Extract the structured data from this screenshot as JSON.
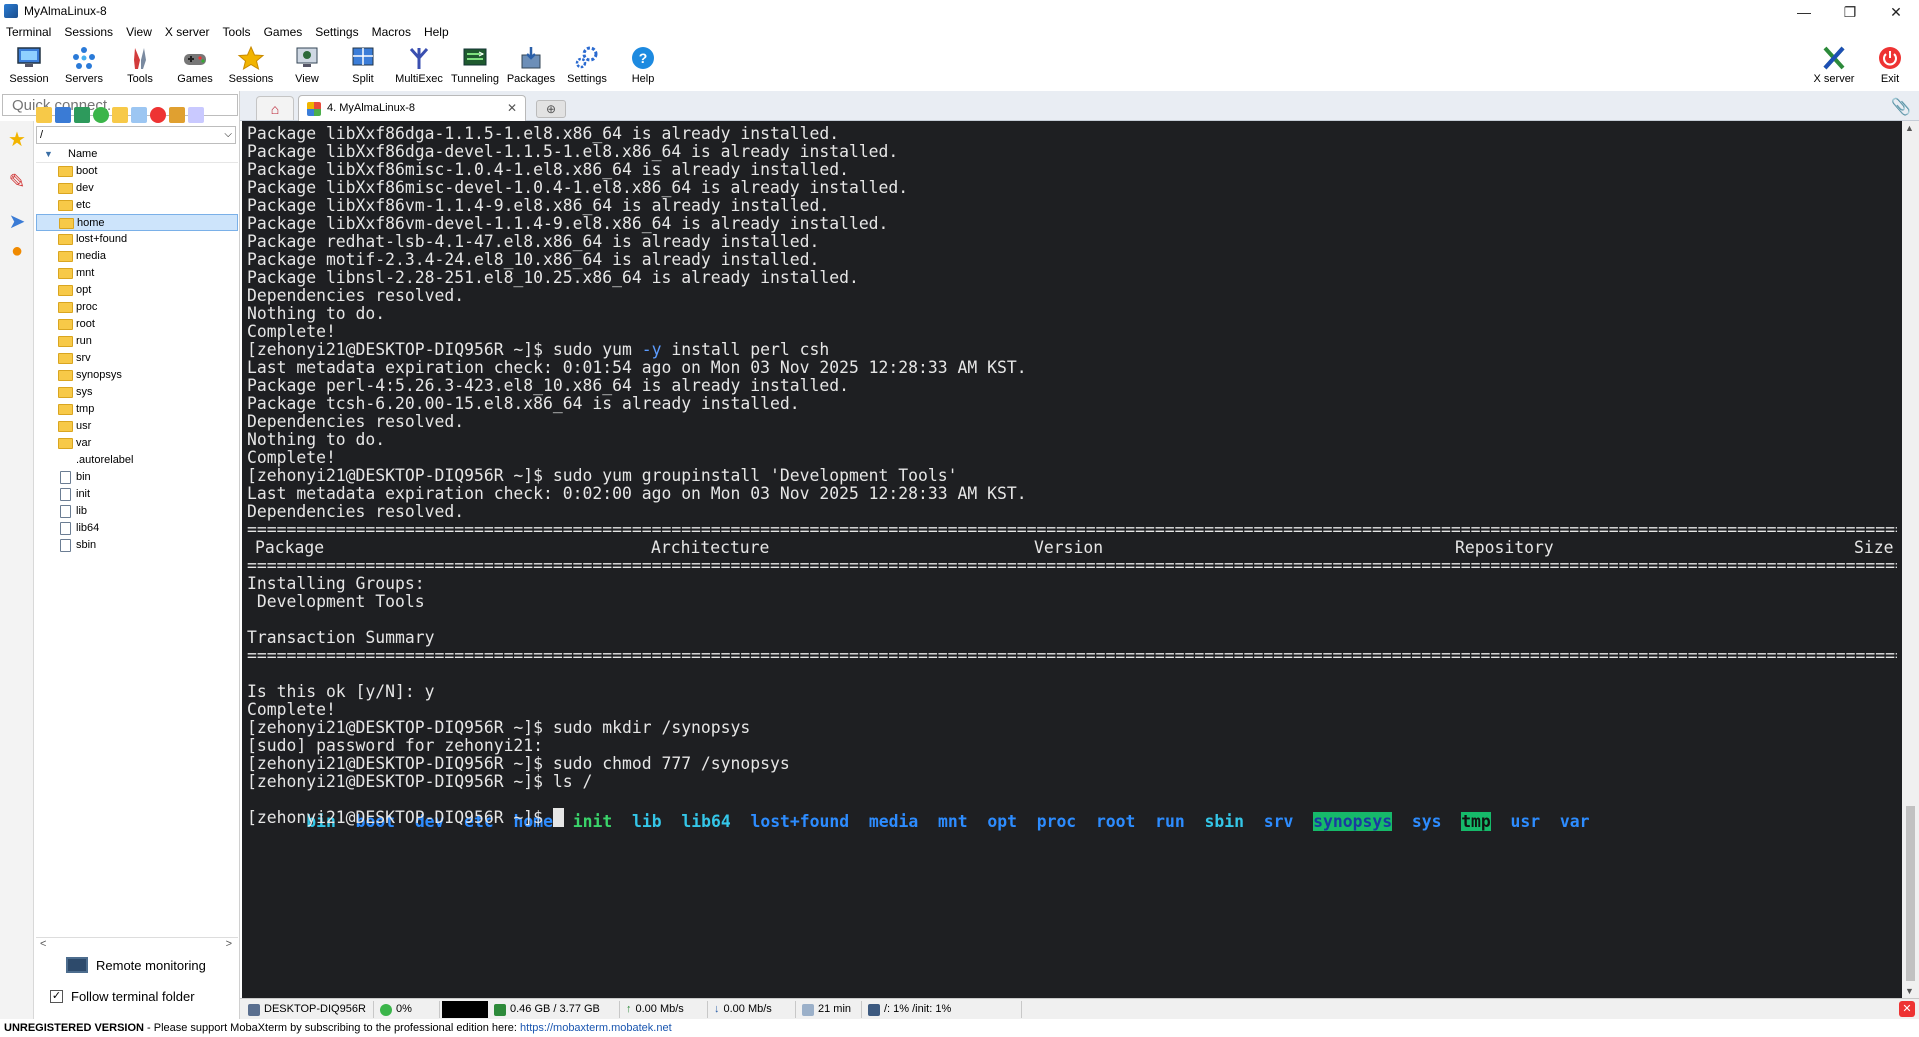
{
  "window": {
    "title": "MyAlmaLinux-8",
    "controls": [
      "—",
      "❐",
      "✕"
    ]
  },
  "menu": [
    "Terminal",
    "Sessions",
    "View",
    "X server",
    "Tools",
    "Games",
    "Settings",
    "Macros",
    "Help"
  ],
  "toolbar": {
    "buttons": [
      "Session",
      "Servers",
      "Tools",
      "Games",
      "Sessions",
      "View",
      "Split",
      "MultiExec",
      "Tunneling",
      "Packages",
      "Settings",
      "Help"
    ],
    "right_buttons": [
      "X server",
      "Exit"
    ]
  },
  "quick_connect": {
    "placeholder": "Quick connect..."
  },
  "sftp": {
    "path": "/",
    "column_header": "Name",
    "items": [
      "boot",
      "dev",
      "etc",
      "home",
      "lost+found",
      "media",
      "mnt",
      "opt",
      "proc",
      "root",
      "run",
      "srv",
      "synopsys",
      "sys",
      "tmp",
      "usr",
      "var",
      ".autorelabel",
      "bin",
      "init",
      "lib",
      "lib64",
      "sbin"
    ],
    "selected": "home",
    "remote_monitoring": "Remote monitoring",
    "follow_terminal": "Follow terminal folder"
  },
  "tabs": {
    "active_tab": "4. MyAlmaLinux-8"
  },
  "terminal": {
    "lines": [
      "Package libXxf86dga-1.1.5-1.el8.x86_64 is already installed.",
      "Package libXxf86dga-devel-1.1.5-1.el8.x86_64 is already installed.",
      "Package libXxf86misc-1.0.4-1.el8.x86_64 is already installed.",
      "Package libXxf86misc-devel-1.0.4-1.el8.x86_64 is already installed.",
      "Package libXxf86vm-1.1.4-9.el8.x86_64 is already installed.",
      "Package libXxf86vm-devel-1.1.4-9.el8.x86_64 is already installed.",
      "Package redhat-lsb-4.1-47.el8.x86_64 is already installed.",
      "Package motif-2.3.4-24.el8_10.x86_64 is already installed.",
      "Package libnsl-2.28-251.el8_10.25.x86_64 is already installed.",
      "Dependencies resolved.",
      "Nothing to do.",
      "Complete!"
    ],
    "cmd1_pre": "[zehonyi21@DESKTOP-DIQ956R ~]$ sudo yum ",
    "cmd1_opt": "-y",
    "cmd1_post": " install perl csh",
    "lines2": [
      "Last metadata expiration check: 0:01:54 ago on Mon 03 Nov 2025 12:28:33 AM KST.",
      "Package perl-4:5.26.3-423.el8_10.x86_64 is already installed.",
      "Package tcsh-6.20.00-15.el8.x86_64 is already installed.",
      "Dependencies resolved.",
      "Nothing to do.",
      "Complete!",
      "[zehonyi21@DESKTOP-DIQ956R ~]$ sudo yum groupinstall 'Development Tools'",
      "Last metadata expiration check: 0:02:00 ago on Mon 03 Nov 2025 12:28:33 AM KST.",
      "Dependencies resolved."
    ],
    "table_headers": [
      "Package",
      "Architecture",
      "Version",
      "Repository",
      "Size"
    ],
    "installing_groups": "Installing Groups:",
    "group_name": " Development Tools",
    "transaction_summary": "Transaction Summary",
    "lines3": [
      "Is this ok [y/N]: y",
      "Complete!",
      "[zehonyi21@DESKTOP-DIQ956R ~]$ sudo mkdir /synopsys",
      "[sudo] password for zehonyi21:",
      "[zehonyi21@DESKTOP-DIQ956R ~]$ sudo chmod 777 /synopsys",
      "[zehonyi21@DESKTOP-DIQ956R ~]$ ls /"
    ],
    "ls_output": [
      {
        "name": "bin",
        "kind": "link"
      },
      {
        "name": "boot",
        "kind": "dir"
      },
      {
        "name": "dev",
        "kind": "dir"
      },
      {
        "name": "etc",
        "kind": "dir"
      },
      {
        "name": "home",
        "kind": "dir"
      },
      {
        "name": "init",
        "kind": "exec"
      },
      {
        "name": "lib",
        "kind": "link"
      },
      {
        "name": "lib64",
        "kind": "link"
      },
      {
        "name": "lost+found",
        "kind": "dir"
      },
      {
        "name": "media",
        "kind": "dir"
      },
      {
        "name": "mnt",
        "kind": "dir"
      },
      {
        "name": "opt",
        "kind": "dir"
      },
      {
        "name": "proc",
        "kind": "dir"
      },
      {
        "name": "root",
        "kind": "dir"
      },
      {
        "name": "run",
        "kind": "dir"
      },
      {
        "name": "sbin",
        "kind": "link"
      },
      {
        "name": "srv",
        "kind": "dir"
      },
      {
        "name": "synopsys",
        "kind": "sticky"
      },
      {
        "name": "sys",
        "kind": "dir"
      },
      {
        "name": "tmp",
        "kind": "tmp"
      },
      {
        "name": "usr",
        "kind": "dir"
      },
      {
        "name": "var",
        "kind": "dir"
      }
    ],
    "prompt": "[zehonyi21@DESKTOP-DIQ956R ~]$ "
  },
  "status": {
    "host": "DESKTOP-DIQ956R",
    "cpu": "0%",
    "memory": "0.46 GB / 3.77 GB",
    "upload": "0.00 Mb/s",
    "download": "0.00 Mb/s",
    "uptime": "21 min",
    "disk": "/: 1%   /init: 1%"
  },
  "footer": {
    "unregistered": "UNREGISTERED VERSION",
    "message": "  -  Please support MobaXterm by subscribing to the professional edition here:  ",
    "link": "https://mobaxterm.mobatek.net"
  },
  "colors": {
    "terminal_bg": "#1e1f22",
    "dir": "#2d8cff",
    "exec": "#3ad36a",
    "link": "#34c6e8",
    "sticky_bg": "#16b96a"
  }
}
